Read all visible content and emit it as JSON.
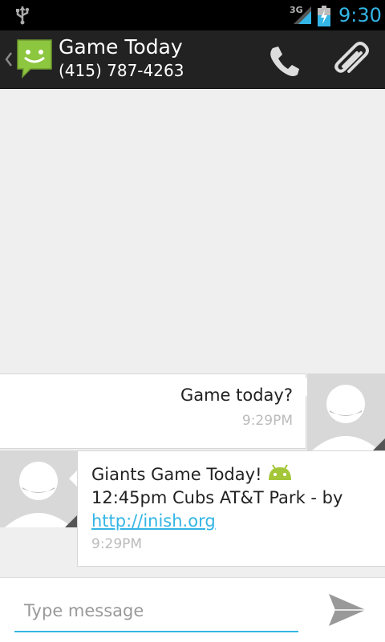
{
  "status_bar": {
    "network": "3G",
    "time": "9:30",
    "icons": [
      "usb-icon",
      "signal-icon",
      "battery-charging-icon"
    ]
  },
  "action_bar": {
    "contact_name": "Game Today",
    "contact_number": "(415) 787-4263",
    "icons": [
      "back-chevron-icon",
      "messaging-app-icon",
      "phone-icon",
      "paperclip-icon"
    ]
  },
  "messages": [
    {
      "direction": "outgoing",
      "text": "Game today?",
      "time": "9:29PM"
    },
    {
      "direction": "incoming",
      "line1": "Giants Game Today!",
      "line2": "12:45pm Cubs AT&T Park - by",
      "link": "http://inish.org",
      "time": "9:29PM",
      "emoji": "android-icon"
    }
  ],
  "compose": {
    "placeholder": "Type message",
    "value": "",
    "send_icon": "send-icon"
  },
  "colors": {
    "accent": "#33b5e5",
    "action_bar": "#222222",
    "background": "#efefef",
    "bubble": "#ffffff",
    "android_green": "#a4c639",
    "messaging_green": "#8dc63f"
  }
}
